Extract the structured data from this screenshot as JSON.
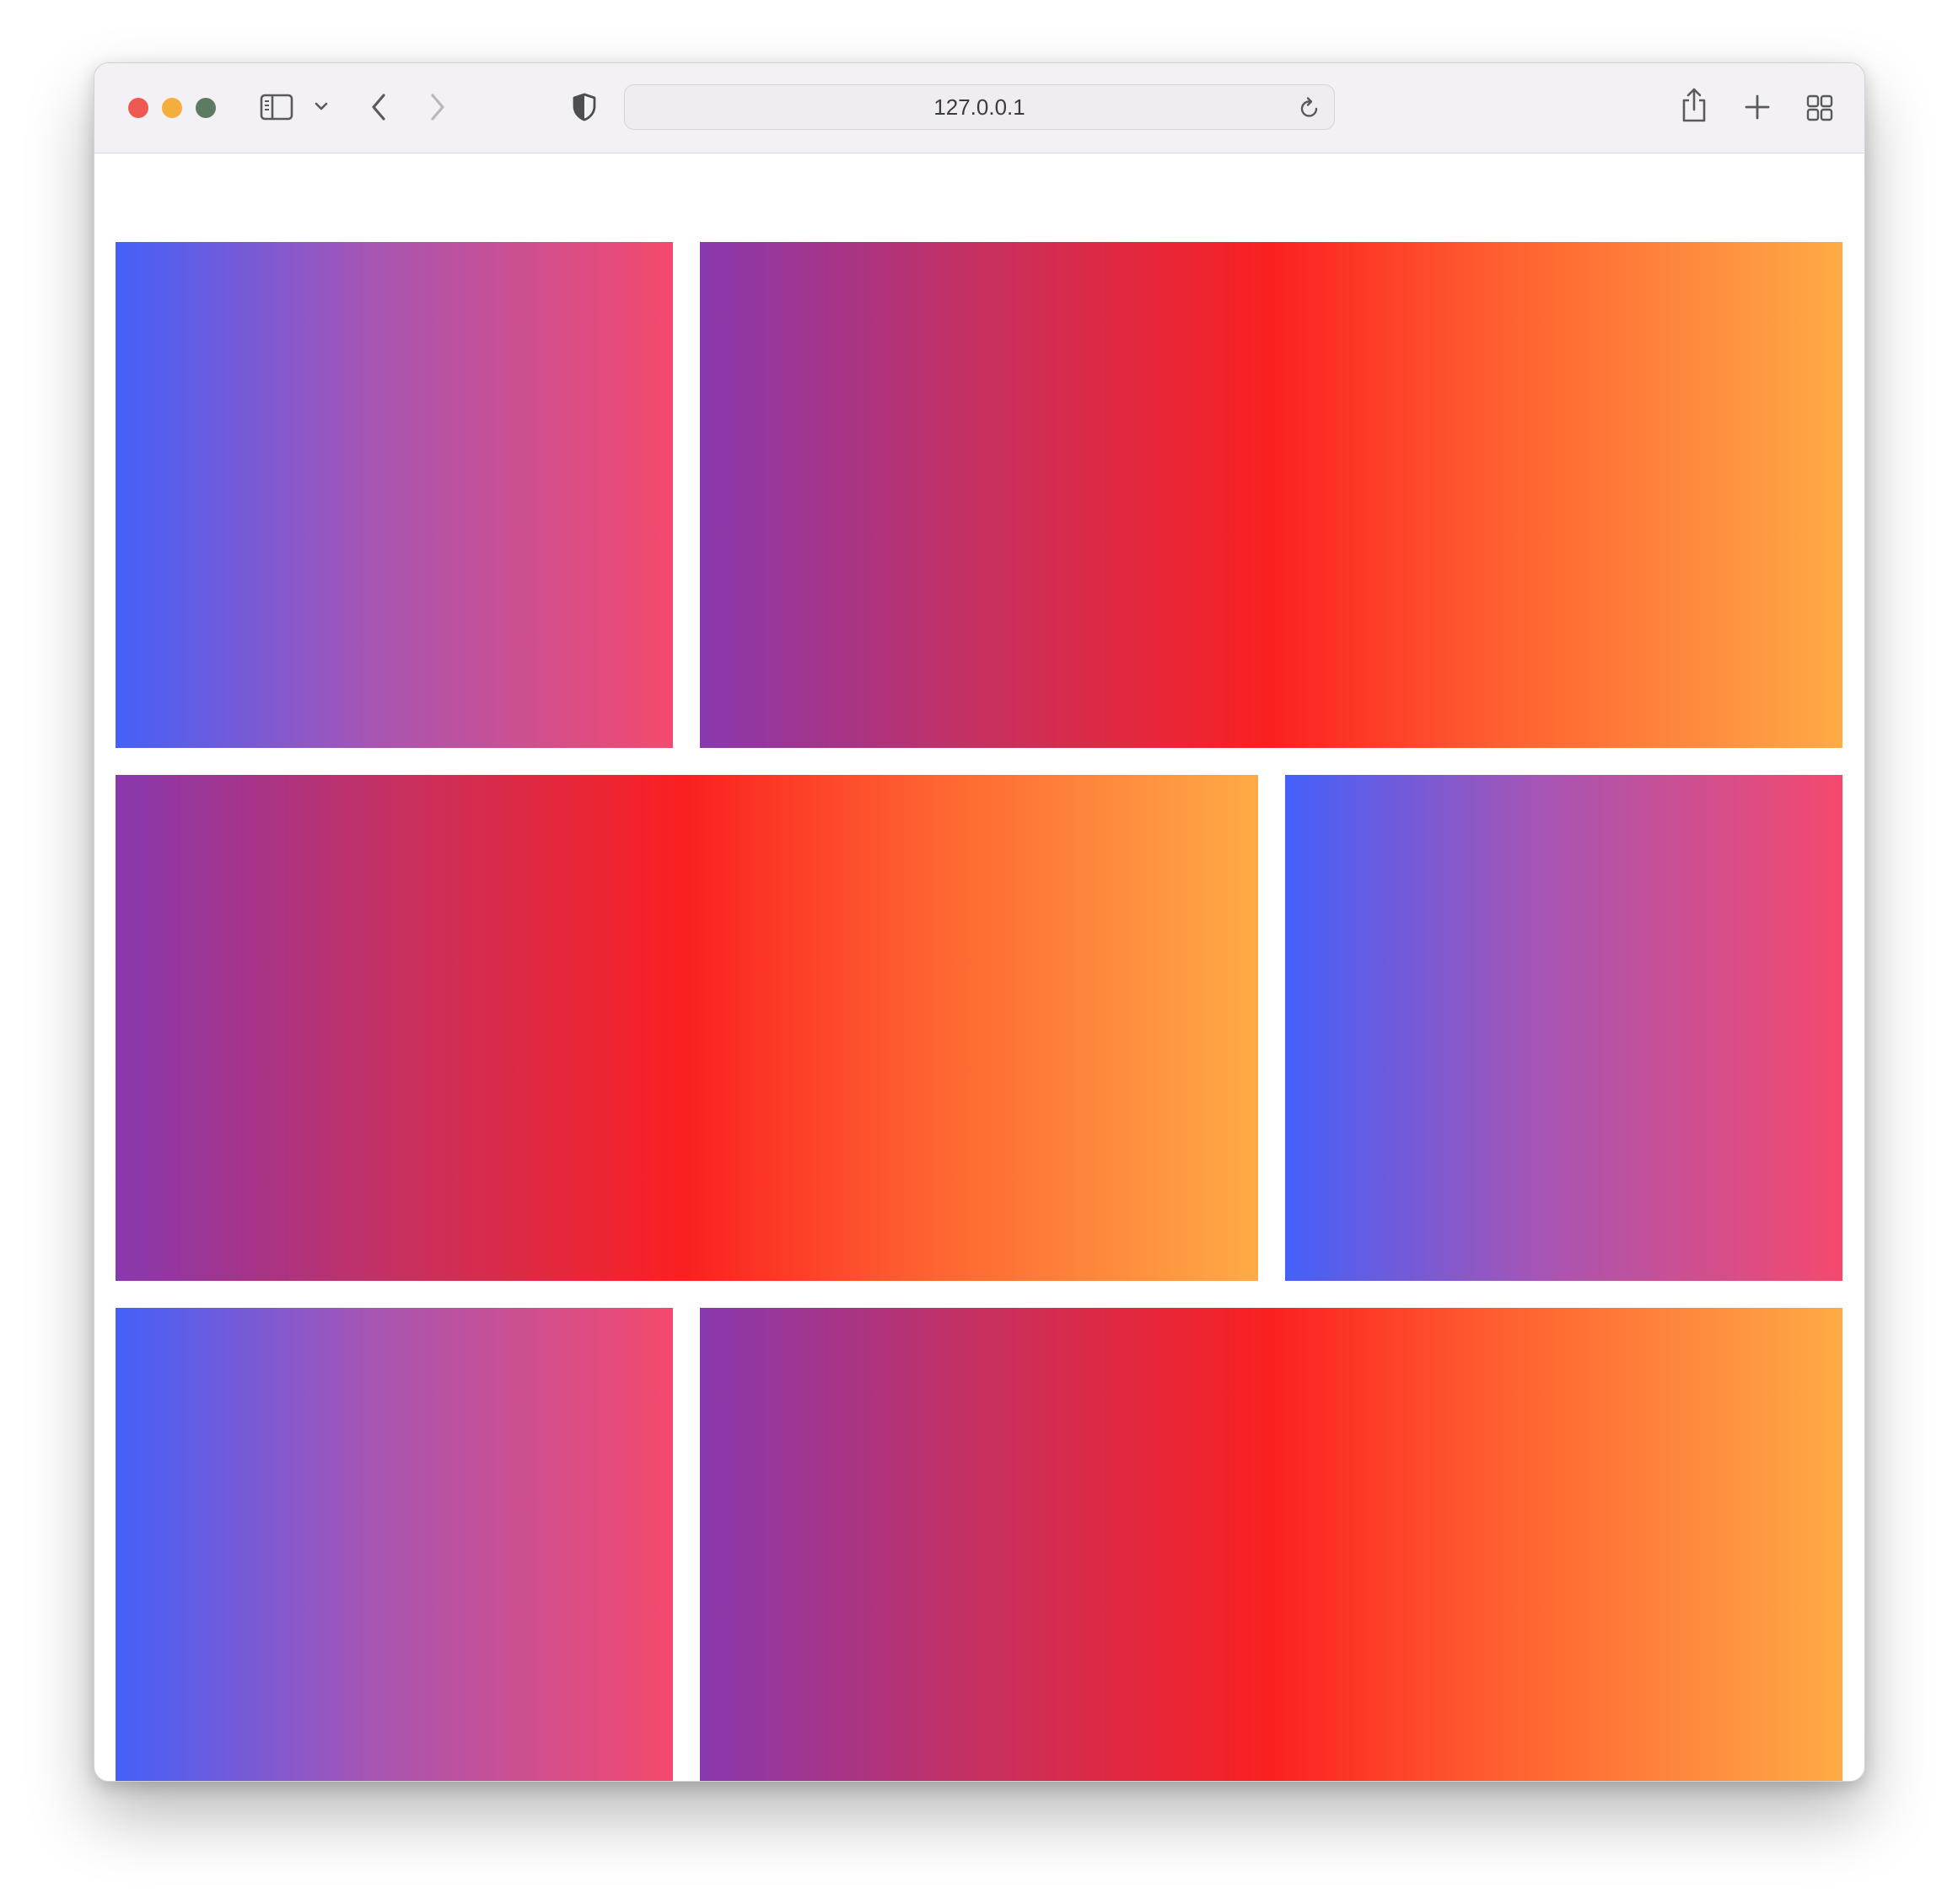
{
  "browser": {
    "url": "127.0.0.1",
    "traffic_lights": [
      "close",
      "minimize",
      "zoom"
    ],
    "toolbar_icons": [
      "sidebar-icon",
      "chevron-down-icon",
      "back-icon",
      "forward-icon",
      "shield-icon",
      "reload-icon",
      "share-icon",
      "plus-icon",
      "tab-overview-icon"
    ]
  },
  "page": {
    "tiles": [
      {
        "row": 1,
        "gradient": "blue-to-pink",
        "colors": [
          "#4460fa",
          "#a555b5",
          "#f5496d"
        ]
      },
      {
        "row": 1,
        "gradient": "purple-red-orange",
        "colors": [
          "#8838ae",
          "#fb2020",
          "#feab47"
        ]
      },
      {
        "row": 2,
        "gradient": "purple-red-orange",
        "colors": [
          "#8838ae",
          "#fb2020",
          "#feab47"
        ]
      },
      {
        "row": 2,
        "gradient": "blue-to-pink",
        "colors": [
          "#4460fa",
          "#a555b5",
          "#f5496d"
        ]
      },
      {
        "row": 3,
        "gradient": "blue-to-pink",
        "colors": [
          "#4460fa",
          "#a555b5",
          "#f5496d"
        ]
      },
      {
        "row": 3,
        "gradient": "purple-red-orange",
        "colors": [
          "#8838ae",
          "#fb2020",
          "#feab47"
        ]
      }
    ]
  }
}
